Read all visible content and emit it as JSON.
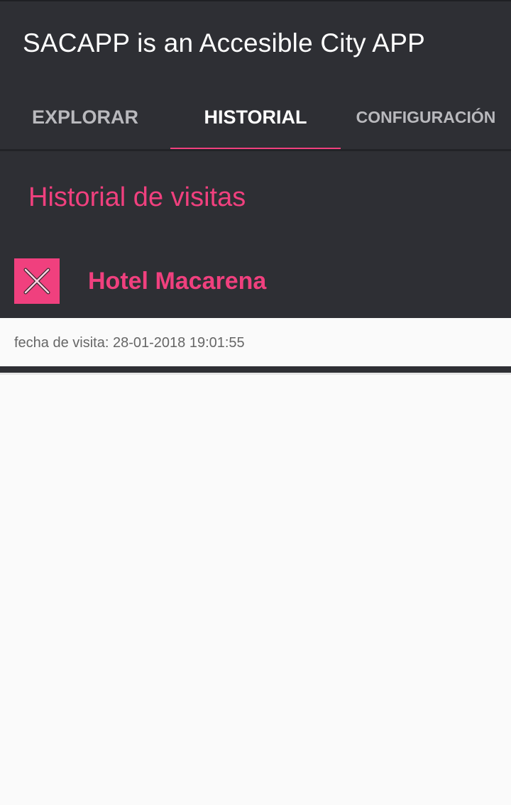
{
  "app": {
    "title": "SACAPP is an Accesible City APP"
  },
  "tabs": [
    {
      "label": "EXPLORAR",
      "active": false
    },
    {
      "label": "HISTORIAL",
      "active": true
    },
    {
      "label": "CONFIGURACIÓN",
      "active": false
    }
  ],
  "history": {
    "title": "Historial de visitas",
    "items": [
      {
        "name": "Hotel Macarena",
        "visit_text": "fecha de visita: 28-01-2018 19:01:55",
        "action_icon": "close-icon"
      }
    ]
  },
  "colors": {
    "accent": "#f0407e",
    "background_dark": "#2e2f34",
    "background_light": "#fafafa"
  }
}
